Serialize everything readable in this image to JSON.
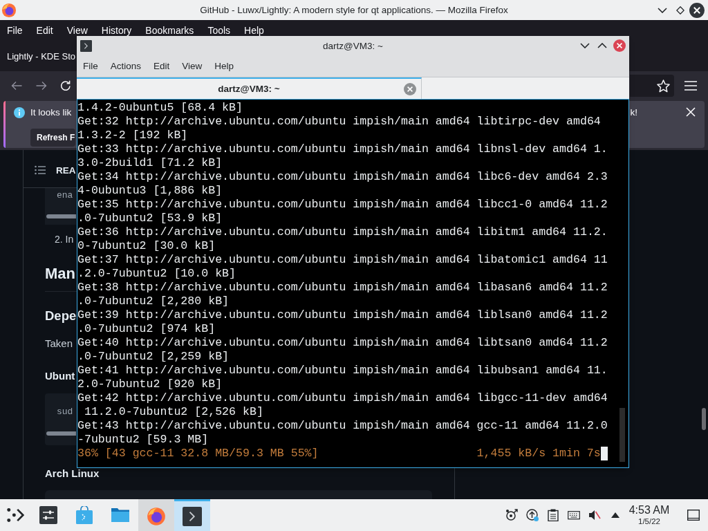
{
  "browser": {
    "title": "GitHub - Luwx/Lightly: A modern style for qt applications. — Mozilla Firefox",
    "menu": [
      "File",
      "Edit",
      "View",
      "History",
      "Bookmarks",
      "Tools",
      "Help"
    ],
    "tab": {
      "label": "Lightly - KDE Sto"
    },
    "nav": {
      "back": {
        "disabled": true
      },
      "forward": {
        "disabled": true
      }
    },
    "notification": {
      "message": "It looks lik",
      "message_end": "k!",
      "button": "Refresh F"
    },
    "page": {
      "readme_title": "REA",
      "blocks": [
        {
          "kind": "code",
          "text": "ena"
        },
        {
          "kind": "list_item",
          "text": "2. In"
        },
        {
          "kind": "h1",
          "text": "Man"
        },
        {
          "kind": "h2",
          "text": "Depe"
        },
        {
          "kind": "paragraph",
          "text": "Taken"
        },
        {
          "kind": "h3",
          "text": "Ubunt"
        },
        {
          "kind": "code",
          "text": "sud"
        },
        {
          "kind": "h3",
          "text": "Arch Linux"
        },
        {
          "kind": "code"
        }
      ]
    }
  },
  "terminal": {
    "title": "dartz@VM3: ~",
    "menu": [
      "File",
      "Actions",
      "Edit",
      "View",
      "Help"
    ],
    "tabs": [
      {
        "label": "dartz@VM3: ~",
        "selected": true
      }
    ],
    "lines": [
      "1.4.2-0ubuntu5 [68.4 kB]",
      "Get:32 http://archive.ubuntu.com/ubuntu impish/main amd64 libtirpc-dev amd64",
      "1.3.2-2 [192 kB]",
      "Get:33 http://archive.ubuntu.com/ubuntu impish/main amd64 libnsl-dev amd64 1.",
      "3.0-2build1 [71.2 kB]",
      "Get:34 http://archive.ubuntu.com/ubuntu impish/main amd64 libc6-dev amd64 2.3",
      "4-0ubuntu3 [1,886 kB]",
      "Get:35 http://archive.ubuntu.com/ubuntu impish/main amd64 libcc1-0 amd64 11.2",
      ".0-7ubuntu2 [53.9 kB]",
      "Get:36 http://archive.ubuntu.com/ubuntu impish/main amd64 libitm1 amd64 11.2.",
      "0-7ubuntu2 [30.0 kB]",
      "Get:37 http://archive.ubuntu.com/ubuntu impish/main amd64 libatomic1 amd64 11",
      ".2.0-7ubuntu2 [10.0 kB]",
      "Get:38 http://archive.ubuntu.com/ubuntu impish/main amd64 libasan6 amd64 11.2",
      ".0-7ubuntu2 [2,280 kB]",
      "Get:39 http://archive.ubuntu.com/ubuntu impish/main amd64 liblsan0 amd64 11.2",
      ".0-7ubuntu2 [974 kB]",
      "Get:40 http://archive.ubuntu.com/ubuntu impish/main amd64 libtsan0 amd64 11.2",
      ".0-7ubuntu2 [2,259 kB]",
      "Get:41 http://archive.ubuntu.com/ubuntu impish/main amd64 libubsan1 amd64 11.",
      "2.0-7ubuntu2 [920 kB]",
      "Get:42 http://archive.ubuntu.com/ubuntu impish/main amd64 libgcc-11-dev amd64",
      " 11.2.0-7ubuntu2 [2,526 kB]",
      "Get:43 http://archive.ubuntu.com/ubuntu impish/main amd64 gcc-11 amd64 11.2.0",
      "-7ubuntu2 [59.3 MB]"
    ],
    "progress": {
      "status": "36% [43 gcc-11 32.8 MB/59.3 MB 55%]",
      "rate": "1,455 kB/s 1min 7s"
    }
  },
  "taskbar": {
    "tasks": [
      {
        "kind": "browser",
        "selected": false
      },
      {
        "kind": "terminal",
        "selected": true
      }
    ],
    "tray": {
      "volume": {
        "muted": true
      }
    },
    "clock": {
      "time": "4:53 AM",
      "date": "1/5/22"
    }
  }
}
